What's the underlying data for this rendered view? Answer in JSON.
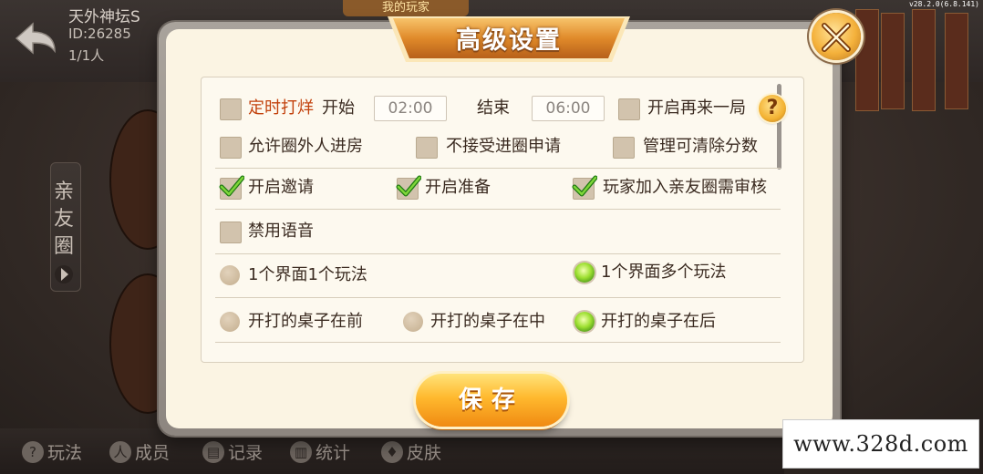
{
  "background": {
    "club_name": "天外神坛S",
    "club_id": "ID:26285",
    "member_count": "1/1人",
    "top_tab": "我的玩家",
    "side_tab_label": "亲友圈",
    "version": "v28.2.0(6.8.141)",
    "bottom_nav": [
      {
        "icon": "?",
        "label": "玩法"
      },
      {
        "icon": "人",
        "label": "成员"
      },
      {
        "icon": "▤",
        "label": "记录"
      },
      {
        "icon": "▥",
        "label": "统计"
      },
      {
        "icon": "♦",
        "label": "皮肤"
      }
    ]
  },
  "dialog": {
    "title": "高级设置",
    "help_label": "?",
    "save_label": "保存"
  },
  "settings": {
    "timed_close": {
      "label": "定时打烊",
      "checked": false
    },
    "start_label": "开始",
    "start_time": "02:00",
    "end_label": "结束",
    "end_time": "06:00",
    "replay": {
      "label": "开启再来一局",
      "checked": false
    },
    "allow_outsiders": {
      "label": "允许圈外人进房",
      "checked": false
    },
    "reject_join": {
      "label": "不接受进圈申请",
      "checked": false
    },
    "admin_clear_score": {
      "label": "管理可清除分数",
      "checked": false
    },
    "enable_invite": {
      "label": "开启邀请",
      "checked": true
    },
    "enable_ready": {
      "label": "开启准备",
      "checked": true
    },
    "join_review": {
      "label": "玩家加入亲友圈需审核",
      "checked": true
    },
    "disable_voice": {
      "label": "禁用语音",
      "checked": false
    },
    "one_game_per_screen": {
      "label": "1个界面1个玩法",
      "selected": false
    },
    "multi_game_per_screen": {
      "label": "1个界面多个玩法",
      "selected": true
    },
    "tables_front": {
      "label": "开打的桌子在前",
      "selected": false
    },
    "tables_middle": {
      "label": "开打的桌子在中",
      "selected": false
    },
    "tables_back": {
      "label": "开打的桌子在后",
      "selected": true
    }
  },
  "watermark": "www.328d.com",
  "colors": {
    "accent_orange": "#f08a12",
    "label_red": "#c2410c",
    "radio_on": "#9ee032",
    "panel_bg": "#fbf4e3"
  }
}
